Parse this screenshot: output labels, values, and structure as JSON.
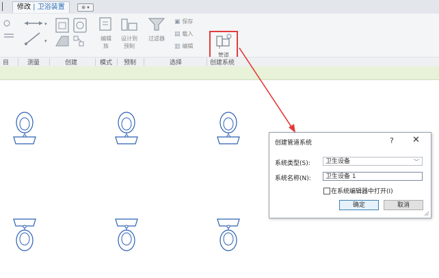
{
  "ribbon": {
    "tab_modify_left": "修改",
    "tab_modify_sep": " | ",
    "tab_context": "卫浴装置",
    "ctx_dropdown": "⊕ ▾",
    "edit_btn": "编辑\n族",
    "edit_btn_l1": "编辑",
    "edit_btn_l2": "族",
    "design_btn_l1": "设计到",
    "design_btn_l2": "预制",
    "filter_btn": "过滤器",
    "save_btn": "保存",
    "load_btn": "载入",
    "edit_small_btn": "编辑",
    "pipe_btn": "管道",
    "panels": {
      "measure": "测量",
      "create": "创建",
      "mode": "模式",
      "prefab": "预制",
      "selection": "选择",
      "create_system": "创建系统",
      "left_partial": "目"
    }
  },
  "dialog": {
    "title": "创建管道系统",
    "help": "?",
    "close": "✕",
    "system_type_label": "系统类型(S):",
    "system_type_value": "卫生设备",
    "system_name_label": "系统名称(N):",
    "system_name_value": "卫生设备 1",
    "open_in_editor_label": "在系统编辑器中打开(I)",
    "open_in_editor_checked": false,
    "ok": "确定",
    "cancel": "取消"
  },
  "colors": {
    "highlight": "#e23b3b",
    "fixture_stroke": "#2a5fb3",
    "options_bar": "#e7f2d8"
  },
  "icons": [
    "pipe-icon",
    "filter-icon",
    "edit-family-icon",
    "measure-icon",
    "create-icon",
    "save-icon",
    "load-icon",
    "edit-icon",
    "toilet-fixture-icon"
  ]
}
